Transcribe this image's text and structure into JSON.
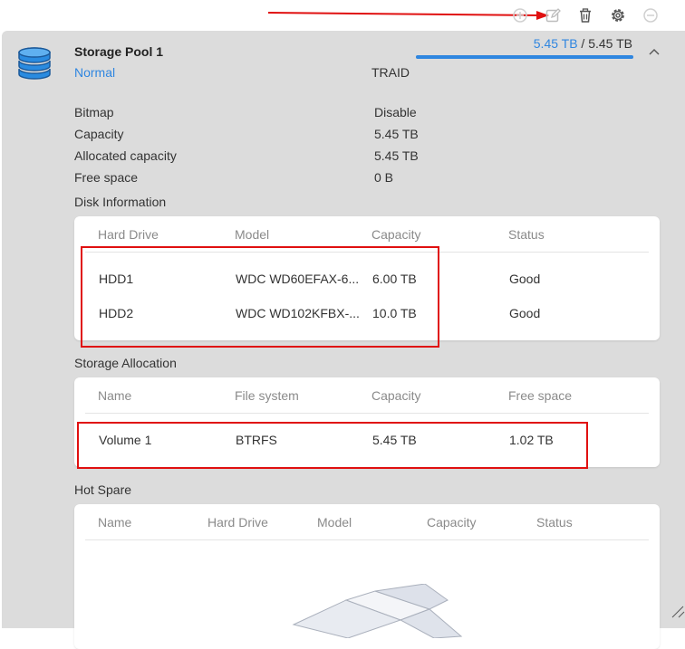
{
  "toolbar": {
    "buttons": [
      {
        "name": "add-icon"
      },
      {
        "name": "edit-icon"
      },
      {
        "name": "delete-icon"
      },
      {
        "name": "settings-icon"
      },
      {
        "name": "remove-icon"
      }
    ]
  },
  "pool": {
    "name": "Storage Pool 1",
    "status": "Normal",
    "raid_type": "TRAID",
    "used": "5.45 TB",
    "separator": " / ",
    "total": "5.45 TB",
    "usage_fraction": 1.0
  },
  "properties": [
    {
      "label": "Bitmap",
      "value": "Disable"
    },
    {
      "label": "Capacity",
      "value": "5.45 TB"
    },
    {
      "label": "Allocated capacity",
      "value": "5.45 TB"
    },
    {
      "label": "Free space",
      "value": "0 B"
    }
  ],
  "disk_info": {
    "title": "Disk Information",
    "columns": [
      "Hard Drive",
      "Model",
      "Capacity",
      "Status"
    ],
    "rows": [
      [
        "HDD1",
        "WDC WD60EFAX-6...",
        "6.00 TB",
        "Good"
      ],
      [
        "HDD2",
        "WDC WD102KFBX-...",
        "10.0 TB",
        "Good"
      ]
    ]
  },
  "storage_allocation": {
    "title": "Storage Allocation",
    "columns": [
      "Name",
      "File system",
      "Capacity",
      "Free space"
    ],
    "rows": [
      [
        "Volume 1",
        "BTRFS",
        "5.45 TB",
        "1.02 TB"
      ]
    ]
  },
  "hot_spare": {
    "title": "Hot Spare",
    "columns": [
      "Name",
      "Hard Drive",
      "Model",
      "Capacity",
      "Status"
    ]
  },
  "colors": {
    "accent": "#2f86e0",
    "annotation": "#e01010",
    "panel_bg": "#dcdcdc"
  }
}
